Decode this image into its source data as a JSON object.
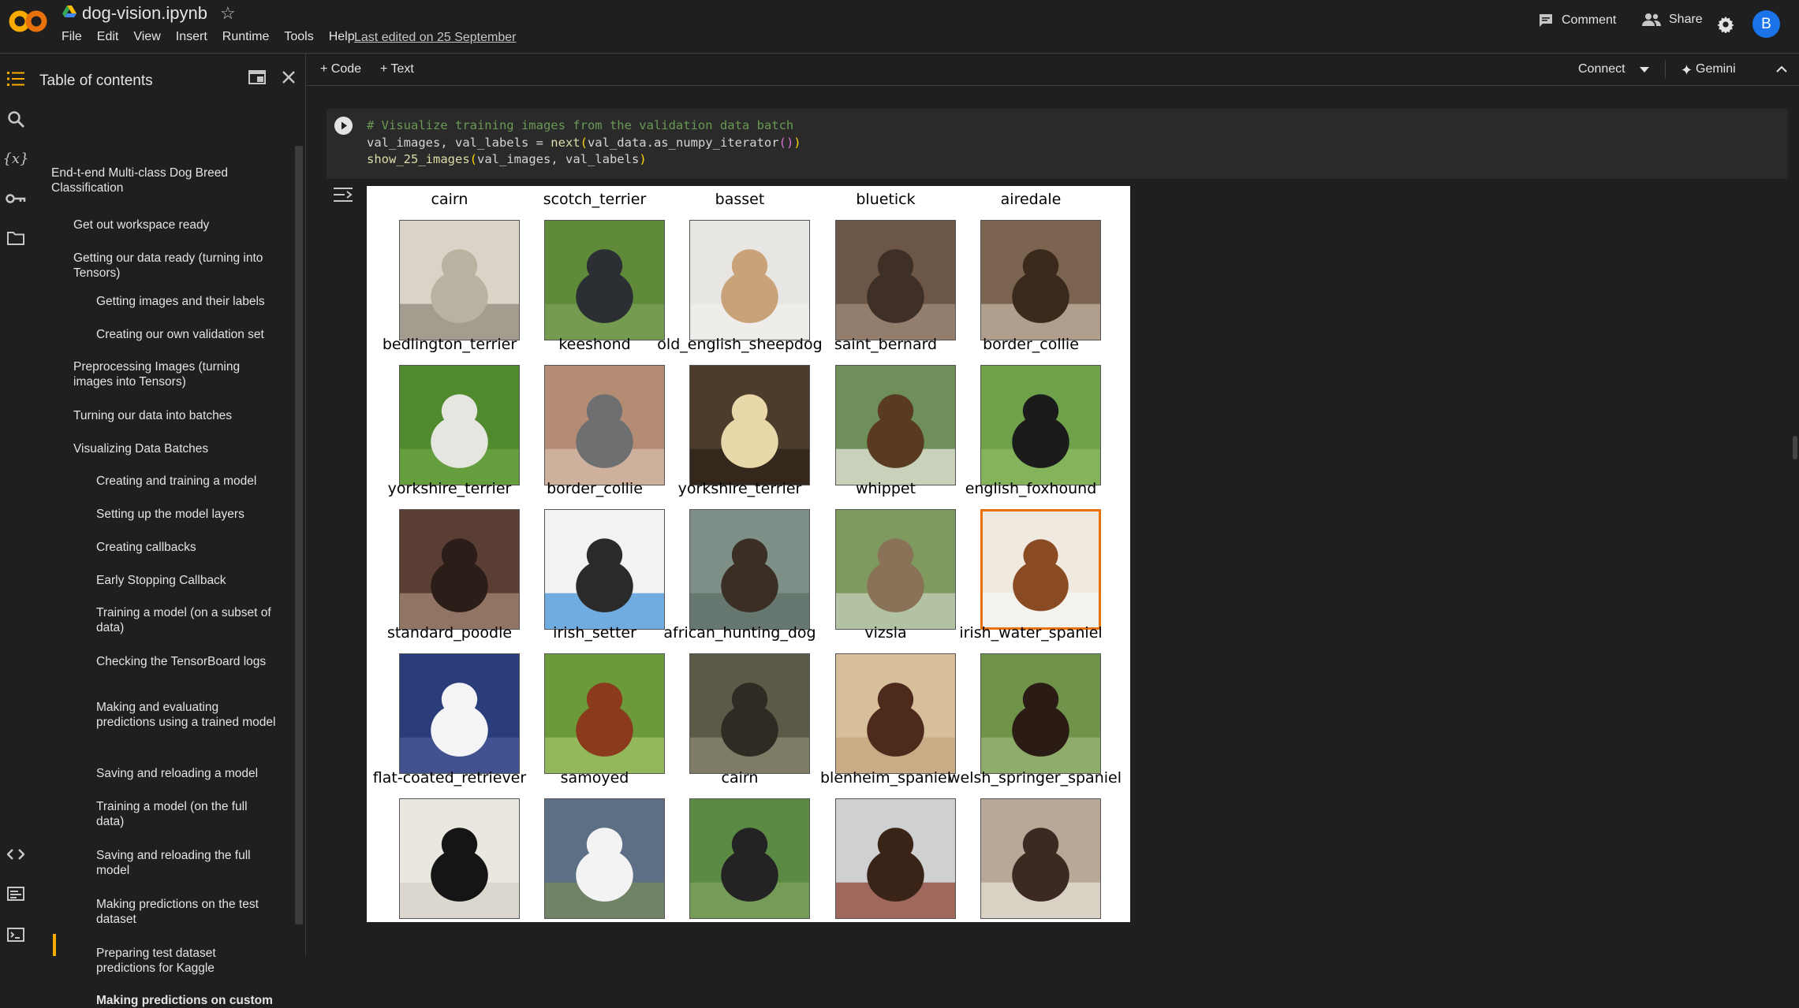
{
  "header": {
    "doc_title": "dog-vision.ipynb",
    "menu": [
      "File",
      "Edit",
      "View",
      "Insert",
      "Runtime",
      "Tools",
      "Help"
    ],
    "last_edited": "Last edited on 25 September",
    "comment_label": "Comment",
    "share_label": "Share",
    "avatar_initial": "B"
  },
  "toc": {
    "title": "Table of contents",
    "items": [
      {
        "label": "End-t-end Multi-class Dog Breed Classification",
        "level": 1
      },
      {
        "label": "Get out workspace ready",
        "level": 2
      },
      {
        "label": "Getting our data ready (turning into Tensors)",
        "level": 2
      },
      {
        "label": "Getting images and their labels",
        "level": 3
      },
      {
        "label": "Creating our own validation set",
        "level": 3
      },
      {
        "label": "Preprocessing Images (turning images into Tensors)",
        "level": 2
      },
      {
        "label": "Turning our data into batches",
        "level": 2
      },
      {
        "label": "Visualizing Data Batches",
        "level": 2
      },
      {
        "label": "Creating and training a model",
        "level": 3
      },
      {
        "label": "Setting up the model layers",
        "level": 3
      },
      {
        "label": "Creating callbacks",
        "level": 3
      },
      {
        "label": "Early Stopping Callback",
        "level": 3
      },
      {
        "label": "Training a model (on a subset of data)",
        "level": 3
      },
      {
        "label": "Checking the TensorBoard logs",
        "level": 3
      },
      {
        "label": "Making and evaluating predictions using a trained model",
        "level": 3
      },
      {
        "label": "Saving and reloading a model",
        "level": 3
      },
      {
        "label": "Training a model (on the full data)",
        "level": 3
      },
      {
        "label": "Saving and reloading the full model",
        "level": 3
      },
      {
        "label": "Making predictions on the test dataset",
        "level": 3
      },
      {
        "label": "Preparing test dataset predictions for Kaggle",
        "level": 3
      },
      {
        "label": "Making predictions on custom",
        "level": 3,
        "active": true
      }
    ]
  },
  "toolbar": {
    "code_label": "+ Code",
    "text_label": "+ Text",
    "connect_label": "Connect",
    "gemini_label": "Gemini"
  },
  "cell": {
    "line1": "# Visualize training images from the validation data batch",
    "line2_a": "val_images, val_labels = ",
    "line2_fn": "next",
    "line2_b": "val_data.as_numpy_iterator",
    "line3_a": "show_25_images",
    "line3_b": "val_images, val_labels"
  },
  "figure": {
    "labels": [
      "cairn",
      "scotch_terrier",
      "basset",
      "bluetick",
      "airedale",
      "bedlington_terrier",
      "keeshond",
      "old_english_sheepdog",
      "saint_bernard",
      "border_collie",
      "yorkshire_terrier",
      "border_collie",
      "yorkshire_terrier",
      "whippet",
      "english_foxhound",
      "standard_poodle",
      "irish_setter",
      "african_hunting_dog",
      "vizsla",
      "irish_water_spaniel",
      "flat-coated_retriever",
      "samoyed",
      "cairn",
      "blenheim_spaniel",
      "welsh_springer_spaniel"
    ],
    "tile_colors": [
      [
        "#d9d4c7",
        "#b9b2a1",
        "#8d8576"
      ],
      [
        "#5f8a3a",
        "#2b2f33",
        "#7ea35a"
      ],
      [
        "#e8e6e3",
        "#c9a27a",
        "#f2f0ed"
      ],
      [
        "#6b5647",
        "#3e2f27",
        "#a48f7d"
      ],
      [
        "#7a6450",
        "#3b2a1c",
        "#c8b8a6"
      ],
      [
        "#4f8a2f",
        "#e6e6e0",
        "#6fa643"
      ],
      [
        "#b48c74",
        "#6e6f70",
        "#d9c1ae"
      ],
      [
        "#4c3c2c",
        "#e8d7a8",
        "#2b1f15"
      ],
      [
        "#6f8f5a",
        "#5a3b22",
        "#f0ece4"
      ],
      [
        "#6ea14a",
        "#1b1b1b",
        "#8dbb63"
      ],
      [
        "#5a3e33",
        "#2b1d18",
        "#a88b78"
      ],
      [
        "#f2f2f0",
        "#2a2a2a",
        "#3a8fd8"
      ],
      [
        "#7d8f86",
        "#3b2e24",
        "#5b6c64"
      ],
      [
        "#7f9a5f",
        "#8a7258",
        "#c9d3bf"
      ],
      [
        "#efe9e0",
        "#8b4b22",
        "#f5f5f2"
      ],
      [
        "#2b3c7a",
        "#f4f4f6",
        "#4d5b9a"
      ],
      [
        "#6c9a3a",
        "#8b3a1c",
        "#a3c46a"
      ],
      [
        "#5b5a48",
        "#2f2a22",
        "#8f8a72"
      ],
      [
        "#d6bf9a",
        "#4e2a1c",
        "#c4a27c"
      ],
      [
        "#6f9348",
        "#2a1c15",
        "#9db77a"
      ],
      [
        "#eae7e1",
        "#151515",
        "#d5d0c6"
      ],
      [
        "#5d6f84",
        "#f3f3f3",
        "#7b8c5a"
      ],
      [
        "#5b8a45",
        "#232323",
        "#7fa35f"
      ],
      [
        "#cfd0d2",
        "#3a2418",
        "#8b3a2a"
      ],
      [
        "#b8a898",
        "#3a2a22",
        "#e8e2d8"
      ]
    ],
    "highlighted_index": 14
  }
}
